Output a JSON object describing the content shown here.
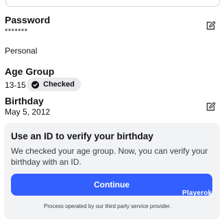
{
  "password": {
    "label": "Password",
    "value": "*******",
    "extra": "Personal",
    "edit_icon": "pencil-edit-icon"
  },
  "age_group": {
    "label": "Age Group",
    "value": "13-15",
    "badge": "Checked",
    "badge_icon": "check-circle-icon"
  },
  "birthday": {
    "label": "Birthday",
    "value": "May 5, 2012",
    "edit_icon": "pencil-edit-icon"
  },
  "verify_card": {
    "title": "Use an ID to verify your birthday",
    "text": "We checked your age group. Now, you can verify your birthday with an ID.",
    "button_label": "Continue",
    "footnote": "Process operated by our third party service provider."
  },
  "watermark": "Playerok",
  "colors": {
    "primary_button": "#335fff",
    "card_background": "#f2f3f5",
    "badge_background": "#e9eaec"
  }
}
